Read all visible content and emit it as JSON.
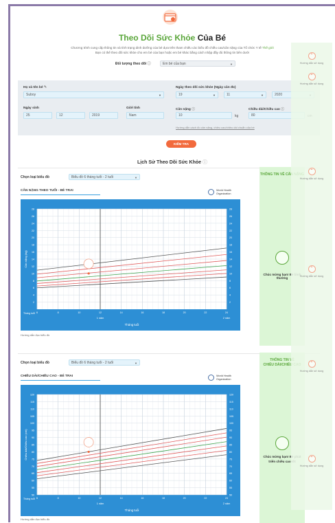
{
  "header": {
    "title_green": "Theo Dõi Sức Khỏe",
    "title_dark": "Của Bé",
    "description_1": "Chương trình cung cấp thông tin và tính trạng dinh dưỡng của bé dựa trên tham chiếu các biểu đồ chiều cao/cân nặng của Tổ chức Y tế",
    "description_link": "Thế giới",
    "description_2": "Bạn có thể theo dõi sức khỏe cho em bé của bạn hoặc em bé khác bằng cách nhập đầy đủ thông tin bên dưới",
    "target_label": "Đối tượng theo dõi",
    "target_value": "Em bé của bạn"
  },
  "form": {
    "name_label": "Họ và tên bé",
    "name_value": "Suboy",
    "tracking_date_label": "Ngày theo dõi sức khỏe (Ngày cân đo)",
    "tracking_day": "19",
    "tracking_month": "11",
    "tracking_year": "2020",
    "dob_label": "Ngày sinh",
    "dob_day": "25",
    "dob_month": "12",
    "dob_year": "2019",
    "gender_label": "Giới tính",
    "gender_value": "Nam",
    "weight_label": "Cân nặng",
    "weight_value": "10",
    "weight_unit": "kg",
    "height_label": "Chiều dài/Chiều cao",
    "height_value": "80",
    "height_unit": "cm",
    "hint": "Hướng dẫn cách đo cân nặng, chiều cao/chiều dài chuẩn của bé",
    "check_button": "KIỂM TRA"
  },
  "history": {
    "title": "Lịch Sử Theo Dõi Sức Khỏe"
  },
  "floating": {
    "guide_text": "Hướng dẫn sử dụng"
  },
  "chart1": {
    "select_label": "Chọn loại biểu đồ",
    "select_value": "Biểu đồ 6 tháng tuổi - 2 tuổi",
    "subtitle": "CÂN NẶNG THEO TUỔI - BÉ TRAI",
    "who_line1": "World Health",
    "who_line2": "Organization",
    "ylabel": "Cân nặng (kg)",
    "xlabel": "Tháng tuổi",
    "corner_label": "Tháng tuổi",
    "year1": "1 năm",
    "year2": "2 năm",
    "guide": "Hướng dẫn đọc biểu đồ",
    "side_title": "THÔNG TIN VỀ CÂN NẶNG",
    "side_msg": "Chúc mừng bạn! Bé bình thường"
  },
  "chart2": {
    "select_label": "Chọn loại biểu đồ",
    "select_value": "Biểu đồ 6 tháng tuổi - 2 tuổi",
    "subtitle": "CHIỀU DÀI/CHIỀU CAO - BÉ TRAI",
    "who_line1": "World Health",
    "who_line2": "Organization",
    "ylabel": "Chiều dài/Chiều cao (cm)",
    "xlabel": "Tháng tuổi",
    "corner_label": "Tháng tuổi",
    "year1": "1 năm",
    "year2": "2 năm",
    "guide": "Hướng dẫn đọc biểu đồ",
    "side_title_1": "THÔNG TIN VỀ",
    "side_title_2": "CHIỀU DÀI/CHIỀU CAO",
    "side_msg": "Chúc mừng bạn! Bé phát triển chiều cao tốt"
  },
  "chart_data": [
    {
      "type": "line",
      "title": "CÂN NẶNG THEO TUỔI - BÉ TRAI",
      "xlabel": "Tháng tuổi",
      "ylabel": "Cân nặng (kg)",
      "xlim": [
        6,
        24
      ],
      "ylim": [
        0,
        28
      ],
      "x_ticks": [
        6,
        8,
        10,
        12,
        14,
        16,
        18,
        20,
        22,
        24
      ],
      "y_ticks": [
        2,
        4,
        6,
        8,
        10,
        12,
        14,
        16,
        18,
        20,
        22,
        24,
        26,
        28
      ],
      "x": [
        6,
        24
      ],
      "series": [
        {
          "values": [
            6.0,
            9.0
          ],
          "color": "#555555"
        },
        {
          "values": [
            6.5,
            10.0
          ],
          "color": "#e05a5a"
        },
        {
          "values": [
            7.2,
            11.0
          ],
          "color": "#e05a5a"
        },
        {
          "values": [
            7.9,
            12.2
          ],
          "color": "#3fa34d"
        },
        {
          "values": [
            8.8,
            13.6
          ],
          "color": "#e05a5a"
        },
        {
          "values": [
            9.8,
            15.3
          ],
          "color": "#e05a5a"
        },
        {
          "values": [
            10.9,
            17.1
          ],
          "color": "#555555"
        }
      ],
      "point": {
        "x": 10.9,
        "y": 10.0
      },
      "grid": true
    },
    {
      "type": "line",
      "title": "CHIỀU DÀI/CHIỀU CAO - BÉ TRAI",
      "xlabel": "Tháng tuổi",
      "ylabel": "Chiều dài/Chiều cao (cm)",
      "xlim": [
        6,
        24
      ],
      "ylim": [
        50,
        120
      ],
      "x_ticks": [
        6,
        8,
        10,
        12,
        14,
        16,
        18,
        20,
        22,
        24
      ],
      "y_ticks": [
        50,
        55,
        60,
        65,
        70,
        75,
        80,
        85,
        90,
        95,
        100,
        105,
        110,
        115,
        120
      ],
      "x": [
        6,
        24
      ],
      "series": [
        {
          "values": [
            61.2,
            78.0
          ],
          "color": "#555555"
        },
        {
          "values": [
            63.3,
            81.0
          ],
          "color": "#e05a5a"
        },
        {
          "values": [
            65.5,
            84.1
          ],
          "color": "#e05a5a"
        },
        {
          "values": [
            67.6,
            87.1
          ],
          "color": "#3fa34d"
        },
        {
          "values": [
            69.8,
            90.2
          ],
          "color": "#e05a5a"
        },
        {
          "values": [
            71.9,
            93.2
          ],
          "color": "#e05a5a"
        },
        {
          "values": [
            74.0,
            96.3
          ],
          "color": "#555555"
        }
      ],
      "point": {
        "x": 10.9,
        "y": 80.0
      },
      "grid": true
    }
  ]
}
